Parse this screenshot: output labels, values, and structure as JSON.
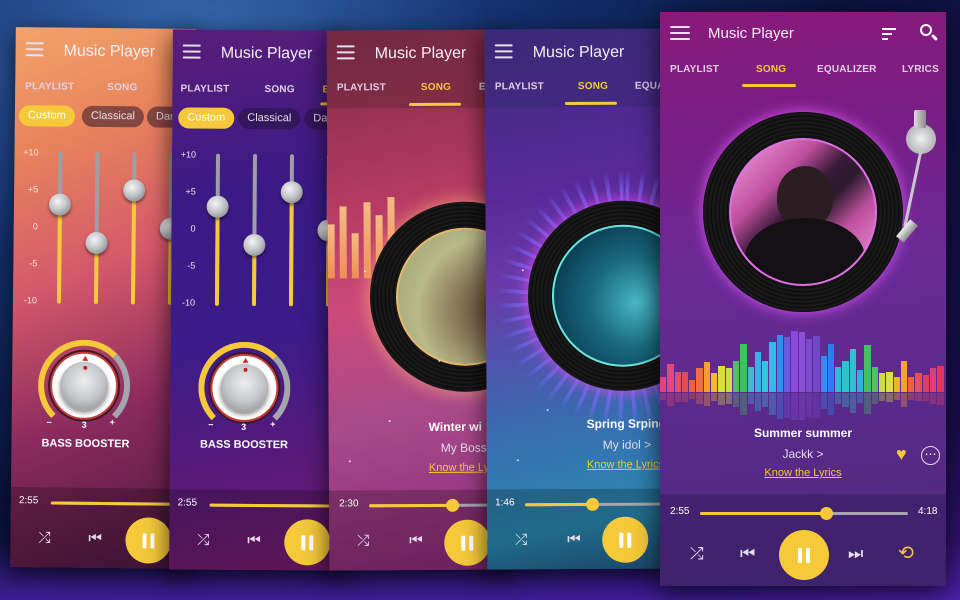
{
  "app_title": "Music Player",
  "colors": {
    "accent": "#f5c93a",
    "progress_track": "#a8a4b0"
  },
  "tabs": [
    "PLAYLIST",
    "SONG",
    "EQUALIZER",
    "LYRICS"
  ],
  "tabs_partial": {
    "eq_e": "E",
    "eq_dan": "Dan",
    "equa": "EQUA"
  },
  "icons": {
    "menu": "hamburger-icon",
    "sort": "sort-icon",
    "search": "search-icon",
    "shuffle": "shuffle-icon",
    "prev": "skip-previous-icon",
    "pause": "pause-icon",
    "next": "skip-next-icon",
    "repeat": "repeat-icon",
    "heart": "heart-icon",
    "more": "more-icon"
  },
  "glyphs": {
    "shuffle": "⤮",
    "prev": "⏮",
    "next": "⏭",
    "repeat": "⟲",
    "heart": "♥",
    "more": "⋯",
    "search": "⌕"
  },
  "equalizer": {
    "presets": [
      "Custom",
      "Classical",
      "Dan"
    ],
    "active_preset": "Custom",
    "scale_labels": [
      "+10",
      "+5",
      "0",
      "-5",
      "-10"
    ],
    "band_values": [
      3,
      -2,
      5,
      0
    ],
    "bass_booster": {
      "label": "BASS BOOSTER",
      "value": "3",
      "minus": "−",
      "plus": "+",
      "level": 0.5
    }
  },
  "screens": [
    {
      "id": "eq-orange",
      "active_tab": "EQUALIZER",
      "time_elapsed": "2:55"
    },
    {
      "id": "eq-purple",
      "active_tab": "EQUALIZER",
      "time_elapsed": "2:55"
    },
    {
      "id": "song-winter",
      "active_tab": "SONG",
      "song_title": "Winter wi",
      "artist": "My Boss",
      "lyrics_link": "Know the Ly",
      "time_elapsed": "2:30",
      "progress": 0.6
    },
    {
      "id": "song-spring",
      "active_tab": "SONG",
      "song_title": "Spring Srping",
      "artist": "My idol >",
      "lyrics_link": "Know the Lyrics",
      "time_elapsed": "1:46",
      "progress": 0.48
    },
    {
      "id": "song-summer",
      "active_tab": "SONG",
      "song_title": "Summer summer",
      "artist": "Jackk >",
      "lyrics_link": "Know the Lyrics",
      "time_elapsed": "2:55",
      "time_total": "4:18",
      "progress": 0.6,
      "favorited": true
    }
  ],
  "visualizer": {
    "levels": [
      0.25,
      0.45,
      0.32,
      0.33,
      0.2,
      0.38,
      0.48,
      0.3,
      0.42,
      0.38,
      0.5,
      0.78,
      0.4,
      0.65,
      0.5,
      0.8,
      0.92,
      0.88,
      0.98,
      0.96,
      0.85,
      0.9,
      0.58,
      0.78,
      0.4,
      0.5,
      0.7,
      0.35,
      0.76,
      0.4,
      0.3,
      0.33,
      0.25,
      0.5,
      0.25,
      0.3,
      0.28,
      0.38,
      0.42
    ],
    "colors": [
      "#e0457a",
      "#e8457a",
      "#e0506a",
      "#d8505a",
      "#f0603a",
      "#f07040",
      "#f5a030",
      "#f5b830",
      "#d8e040",
      "#c8e050",
      "#50c060",
      "#40c060",
      "#40b8e0",
      "#38b0e8",
      "#40c0e0",
      "#38b8e8",
      "#3090f0",
      "#6a5ae0",
      "#8a4ae0",
      "#8a50d8",
      "#7a4ad0",
      "#7048c8",
      "#3090f0",
      "#2a80f0",
      "#30b8d8",
      "#30c0c8",
      "#30c0d0",
      "#30b0e0",
      "#40c060",
      "#50c060",
      "#c8e040",
      "#d8e050",
      "#f5b030",
      "#f5a030",
      "#f06040",
      "#e8505a",
      "#e04060",
      "#e04070",
      "#e03860"
    ]
  },
  "side_bars_winter": [
    0.6,
    0.8,
    0.5,
    0.85,
    0.7,
    0.9
  ]
}
